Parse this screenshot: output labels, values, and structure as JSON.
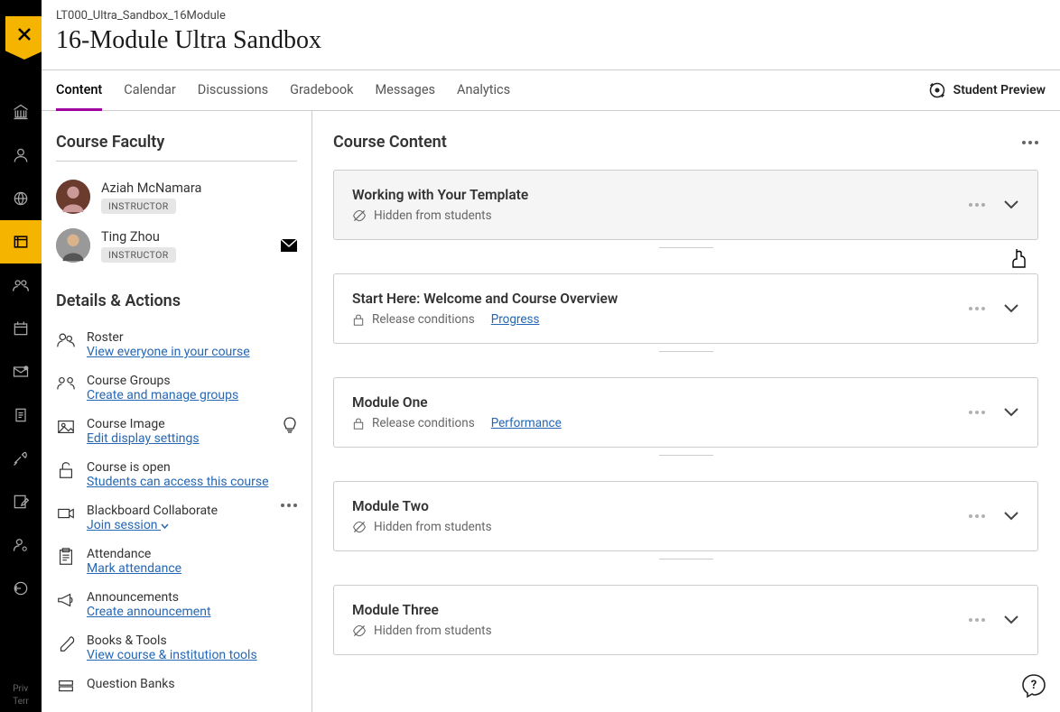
{
  "course": {
    "code": "LT000_Ultra_Sandbox_16Module",
    "title": "16-Module Ultra Sandbox"
  },
  "tabs": {
    "content": "Content",
    "calendar": "Calendar",
    "discussions": "Discussions",
    "gradebook": "Gradebook",
    "messages": "Messages",
    "analytics": "Analytics"
  },
  "student_preview": "Student Preview",
  "sidebar": {
    "faculty_title": "Course Faculty",
    "faculty": [
      {
        "name": "Aziah McNamara",
        "role": "INSTRUCTOR"
      },
      {
        "name": "Ting Zhou",
        "role": "INSTRUCTOR"
      }
    ],
    "details_title": "Details & Actions",
    "details": {
      "roster": {
        "label": "Roster",
        "link": "View everyone in your course"
      },
      "groups": {
        "label": "Course Groups",
        "link": "Create and manage groups"
      },
      "image": {
        "label": "Course Image",
        "link": "Edit display settings"
      },
      "open": {
        "label": "Course is open",
        "link": "Students can access this course"
      },
      "collab": {
        "label": "Blackboard Collaborate",
        "link": "Join session"
      },
      "attendance": {
        "label": "Attendance",
        "link": "Mark attendance"
      },
      "announce": {
        "label": "Announcements",
        "link": "Create announcement"
      },
      "books": {
        "label": "Books & Tools",
        "link": "View course & institution tools"
      },
      "qbanks": {
        "label": "Question Banks"
      }
    }
  },
  "main": {
    "title": "Course Content",
    "items": {
      "template": {
        "title": "Working with Your Template",
        "hidden": "Hidden from students"
      },
      "start": {
        "title": "Start Here: Welcome and Course Overview",
        "release": "Release conditions",
        "progress": "Progress"
      },
      "mod1": {
        "title": "Module One",
        "release": "Release conditions",
        "perf": "Performance"
      },
      "mod2": {
        "title": "Module Two",
        "hidden": "Hidden from students"
      },
      "mod3": {
        "title": "Module Three",
        "hidden": "Hidden from students"
      }
    }
  },
  "rail_footer": {
    "l1": "Priv",
    "l2": "Terr"
  }
}
